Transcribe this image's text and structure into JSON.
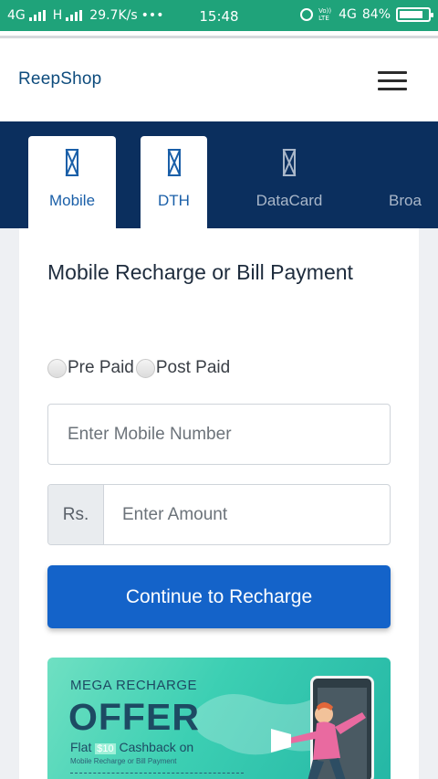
{
  "status_bar": {
    "network1": "4G",
    "network2": "H",
    "speed": "29.7K/s",
    "dots": "•••",
    "time": "15:48",
    "volte": "Vo)) LTE",
    "network3": "4G",
    "battery": "84%",
    "battery_level": 0.84
  },
  "header": {
    "brand": "ReepShop"
  },
  "tabs": [
    {
      "label": "Mobile",
      "active": true
    },
    {
      "label": "DTH",
      "active": true
    },
    {
      "label": "DataCard",
      "active": false
    },
    {
      "label": "Broa",
      "active": false
    }
  ],
  "form": {
    "title": "Mobile Recharge or Bill Payment",
    "radio_prepaid": "Pre Paid",
    "radio_postpaid": "Post Paid",
    "mobile_placeholder": "Enter Mobile Number",
    "currency_prefix": "Rs.",
    "amount_placeholder": "Enter Amount",
    "submit_label": "Continue to Recharge"
  },
  "banner": {
    "heading": "MEGA RECHARGE",
    "offer": "OFFER",
    "flat_prefix": "Flat",
    "flat_amount": "$10",
    "flat_suffix": "Cashback on",
    "subtext": "Mobile Recharge or Bill Payment"
  },
  "colors": {
    "status_bar": "#1fa37a",
    "tab_bar": "#0b2f5e",
    "primary_button": "#1463c9",
    "brand_text": "#0e4c7d"
  }
}
